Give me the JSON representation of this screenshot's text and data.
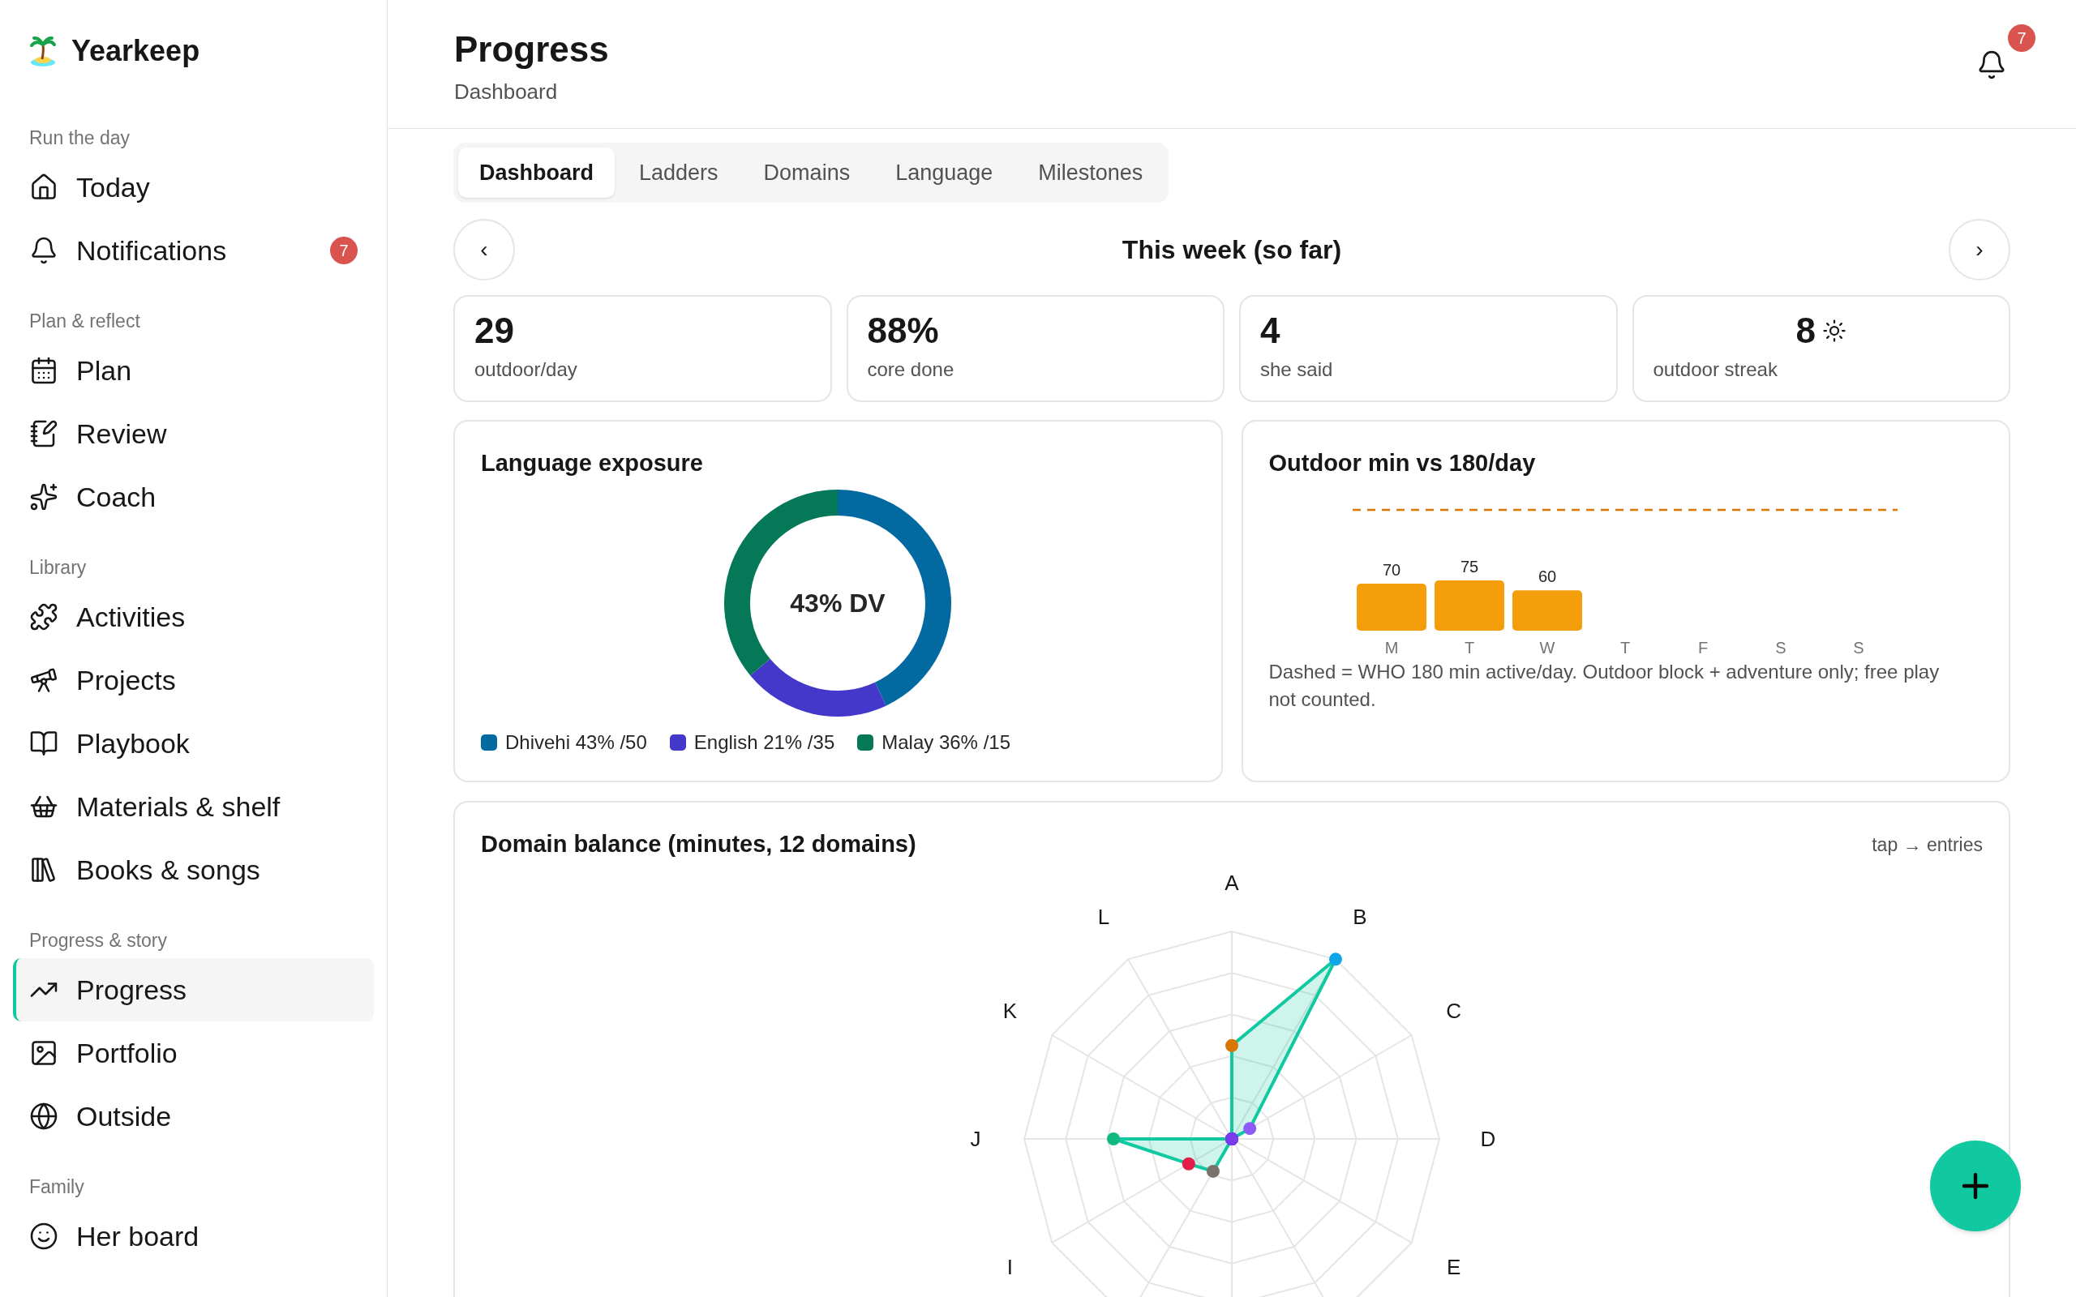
{
  "app": {
    "name": "Yearkeep"
  },
  "sidebar": {
    "sections": [
      {
        "title": "Run the day",
        "items": [
          {
            "label": "Today",
            "selected": false
          },
          {
            "label": "Notifications",
            "badge": "7",
            "selected": false
          }
        ]
      },
      {
        "title": "Plan & reflect",
        "items": [
          {
            "label": "Plan",
            "selected": false
          },
          {
            "label": "Review",
            "selected": false
          },
          {
            "label": "Coach",
            "selected": false
          }
        ]
      },
      {
        "title": "Library",
        "items": [
          {
            "label": "Activities",
            "selected": false
          },
          {
            "label": "Projects",
            "selected": false
          },
          {
            "label": "Playbook",
            "selected": false
          },
          {
            "label": "Materials & shelf",
            "selected": false
          },
          {
            "label": "Books & songs",
            "selected": false
          }
        ]
      },
      {
        "title": "Progress & story",
        "items": [
          {
            "label": "Progress",
            "selected": true
          },
          {
            "label": "Portfolio",
            "selected": false
          },
          {
            "label": "Outside",
            "selected": false
          }
        ]
      },
      {
        "title": "Family",
        "items": [
          {
            "label": "Her board",
            "selected": false
          }
        ]
      }
    ]
  },
  "header": {
    "title": "Progress",
    "subtitle": "Dashboard",
    "notification_badge": "7"
  },
  "tabs": [
    {
      "label": "Dashboard",
      "selected": true
    },
    {
      "label": "Ladders",
      "selected": false
    },
    {
      "label": "Domains",
      "selected": false
    },
    {
      "label": "Language",
      "selected": false
    },
    {
      "label": "Milestones",
      "selected": false
    }
  ],
  "week": {
    "prev": "‹",
    "title": "This week (so far)",
    "next": "›"
  },
  "stats": [
    {
      "value": "29",
      "label": "outdoor/day",
      "kind": "plain"
    },
    {
      "value": "88%",
      "label": "core done",
      "kind": "plain"
    },
    {
      "value": "4",
      "label": "she said",
      "kind": "plain"
    },
    {
      "value": "8",
      "label": "outdoor streak",
      "kind": "streak"
    }
  ],
  "language_card": {
    "title": "Language exposure",
    "center_label": "43% DV",
    "legend": [
      {
        "label": "Dhivehi 43% /50",
        "color": "#0369a1"
      },
      {
        "label": "English 21% /35",
        "color": "#4338ca"
      },
      {
        "label": "Malay 36% /15",
        "color": "#047857"
      }
    ],
    "chart_data": {
      "type": "donut",
      "values": [
        43,
        21,
        36
      ]
    }
  },
  "outdoor_card": {
    "title": "Outdoor min vs 180/day",
    "chart_data": {
      "type": "bar",
      "categories": [
        "M",
        "T",
        "W",
        "T",
        "F",
        "S",
        "S"
      ],
      "series": [
        {
          "color": "#f59e0b",
          "values": [
            70,
            75,
            60,
            null,
            null,
            null,
            null
          ]
        }
      ],
      "data_labels": true
    },
    "note": "Dashed = WHO 180 min active/day. Outdoor block + adventure only; free play not counted."
  },
  "domain_card": {
    "title": "Domain balance (minutes, 12 domains)",
    "hint": "tap → entries",
    "axes": [
      {
        "label": "A"
      },
      {
        "label": "B"
      },
      {
        "label": "C"
      },
      {
        "label": "D"
      },
      {
        "label": "E"
      },
      {
        "label": "I"
      },
      {
        "label": "J"
      },
      {
        "label": "K"
      },
      {
        "label": "L"
      }
    ]
  }
}
